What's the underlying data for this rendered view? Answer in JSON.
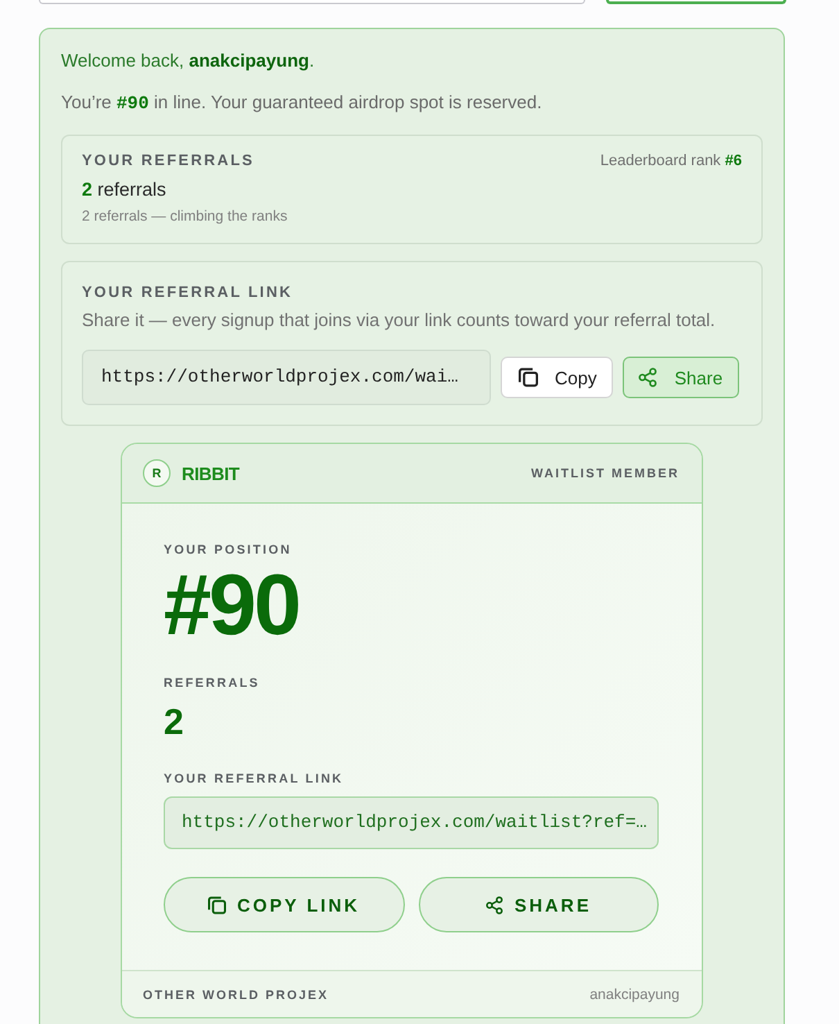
{
  "top_controls": [
    {
      "kind": "field"
    },
    {
      "kind": "button"
    }
  ],
  "welcome": "Welcome back, **anakcipayung**.",
  "status": "You’re **#90** in line. Your guaranteed airdrop spot is reserved.",
  "referrals_panel": {
    "title": "YOUR REFERRALS",
    "rank": "Leaderboard rank **#6**",
    "count": "**2** referrals",
    "note": "2 referrals — climbing the ranks"
  },
  "link_panel": {
    "title": "YOUR REFERRAL LINK",
    "description": "Share it — every signup that joins via your link counts toward your referral total.",
    "link": "https://otherworldprojex.com/wai…",
    "buttons": [
      {
        "kind": "copy",
        "label": "Copy"
      },
      {
        "kind": "share",
        "label": "Share"
      }
    ]
  },
  "card": {
    "logo_letter": "R",
    "brand": "RIBBIT",
    "badge": "WAITLIST MEMBER",
    "position_label": "YOUR POSITION",
    "position": "#90",
    "referrals_label": "REFERRALS",
    "referrals": "2",
    "link_label": "YOUR REFERRAL LINK",
    "link": "https://otherworldprojex.com/waitlist?ref=…",
    "buttons": [
      {
        "kind": "copy",
        "label": "COPY LINK"
      },
      {
        "kind": "share",
        "label": "SHARE"
      }
    ],
    "footer_brand": "OTHER WORLD PROJEX",
    "footer_user": "anakcipayung"
  }
}
